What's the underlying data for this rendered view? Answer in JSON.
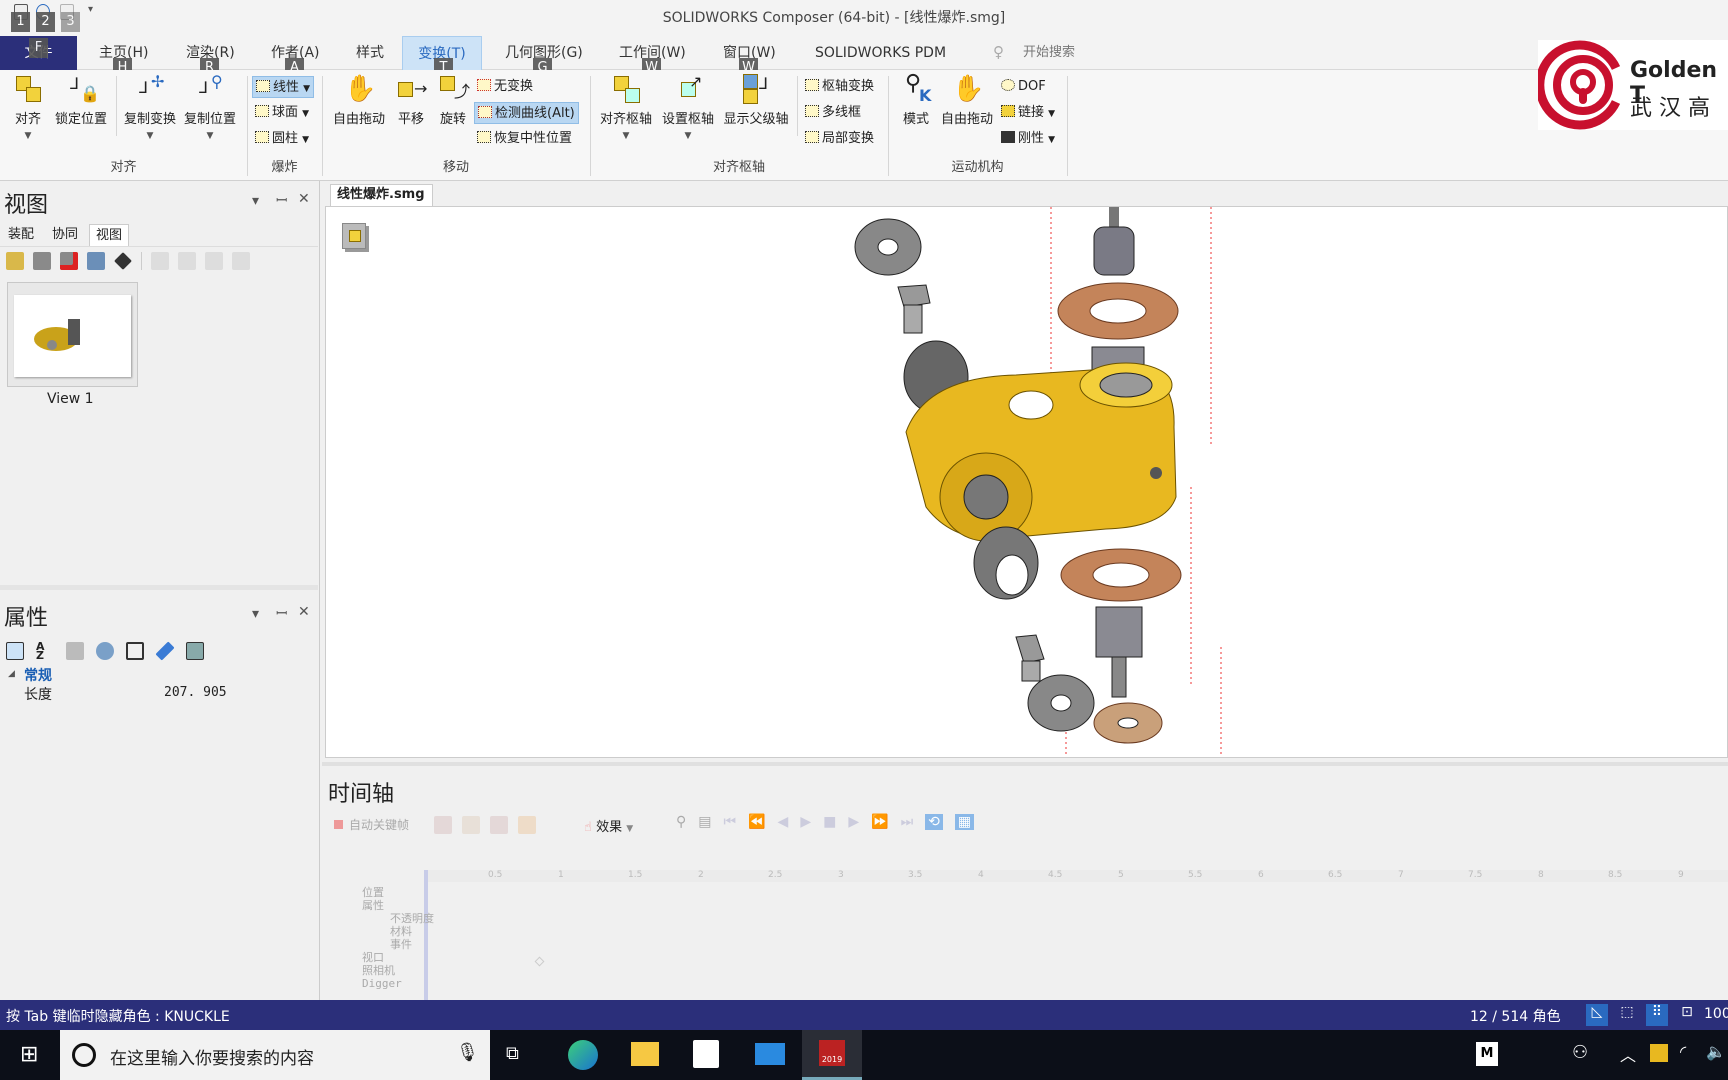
{
  "titlebar": {
    "title": "SOLIDWORKS Composer (64-bit) - [线性爆炸.smg]",
    "keytips": [
      "1",
      "2",
      "3"
    ]
  },
  "tabs": {
    "file": "文件",
    "file_keytip": "F",
    "items": [
      {
        "label": "主页(H)",
        "keytip": "H"
      },
      {
        "label": "渲染(R)",
        "keytip": "R"
      },
      {
        "label": "作者(A)",
        "keytip": "A"
      },
      {
        "label": "样式"
      },
      {
        "label": "变换(T)",
        "keytip": "T",
        "selected": true
      },
      {
        "label": "几何图形(G)",
        "keytip": "G"
      },
      {
        "label": "工作间(W)",
        "keytip": "W"
      },
      {
        "label": "窗口(W)",
        "keytip": "W"
      },
      {
        "label": "SOLIDWORKS PDM"
      }
    ],
    "search": "开始搜索"
  },
  "ribbon": {
    "align": {
      "label": "对齐",
      "align": "对齐",
      "lock": "锁定位置",
      "copy_transform": "复制变换",
      "copy_position": "复制位置"
    },
    "explode": {
      "label": "爆炸",
      "linear": "线性",
      "sphere": "球面",
      "cylinder": "圆柱"
    },
    "move": {
      "label": "移动",
      "free_drag": "自由拖动",
      "translate": "平移",
      "rotate": "旋转",
      "no_transform": "无变换",
      "detect_curve": "检测曲线(Alt)",
      "restore_neutral": "恢复中性位置"
    },
    "pivot": {
      "label": "对齐枢轴",
      "align_pivot": "对齐枢轴",
      "set_pivot": "设置枢轴",
      "show_parent_axis": "显示父级轴",
      "pivot_transform": "枢轴变换",
      "multi_frame": "多线框",
      "local_transform": "局部变换"
    },
    "kinematics": {
      "label": "运动机构",
      "mode": "模式",
      "free_drag": "自由拖动",
      "dof": "DOF",
      "link": "链接",
      "rigid": "刚性"
    }
  },
  "logo": {
    "text_en": "Golden T",
    "text_cn": "武 汉 高",
    "color": "#c8102e"
  },
  "views_panel": {
    "title": "视图",
    "tabs": [
      "装配",
      "协同",
      "视图"
    ],
    "selected_tab": "视图",
    "thumbnail_label": "View 1"
  },
  "properties_panel": {
    "title": "属性",
    "group": "常规",
    "rows": [
      {
        "name": "长度",
        "value": "207. 905"
      }
    ]
  },
  "document": {
    "tab": "线性爆炸.smg"
  },
  "timeline": {
    "title": "时间轴",
    "auto_keyframe": "自动关键帧",
    "effects": "效果",
    "ruler_ticks": [
      "0.5",
      "1",
      "1.5",
      "2",
      "2.5",
      "3",
      "3.5",
      "4",
      "4.5",
      "5",
      "5.5",
      "6",
      "6.5",
      "7",
      "7.5",
      "8",
      "8.5",
      "9"
    ],
    "tracks": [
      "位置",
      "属性",
      "不透明度",
      "材料",
      "事件",
      "视口",
      "照相机",
      "Digger"
    ]
  },
  "statusbar": {
    "hint": "按 Tab 键临时隐藏角色 : KNUCKLE",
    "actors": "12 / 514 角色",
    "zoom": "100"
  },
  "taskbar": {
    "search_placeholder": "在这里输入你要搜索的内容",
    "sw_badge": "2019",
    "ime": "M"
  },
  "colors": {
    "status_bar": "#2b2f7a",
    "selected_tab": "#cde3f7",
    "part_yellow": "#e8b820"
  }
}
